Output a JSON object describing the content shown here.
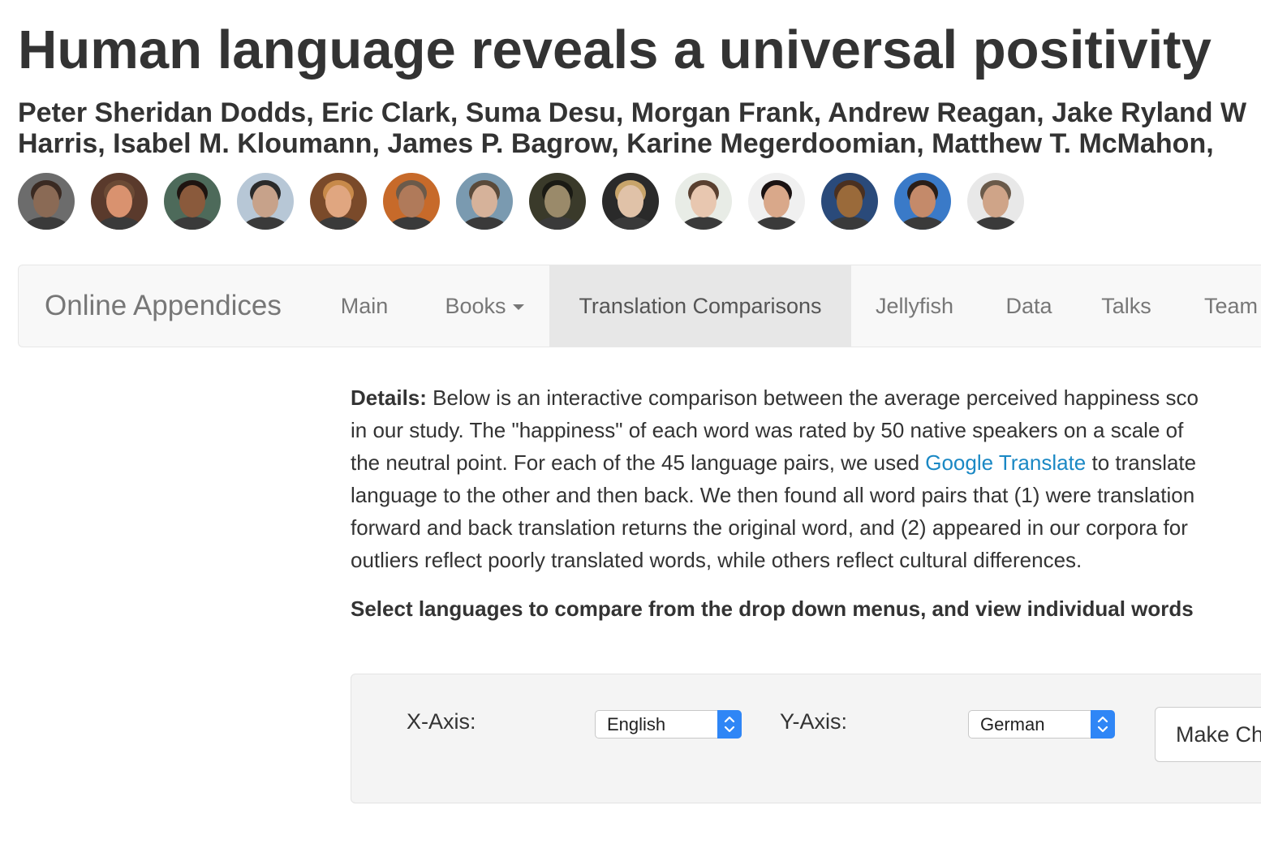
{
  "title": "Human language reveals a universal positivity",
  "authors": {
    "line1": "Peter Sheridan Dodds, Eric Clark, Suma Desu, Morgan Frank, Andrew Reagan, Jake Ryland W",
    "line2": "Harris, Isabel M. Kloumann, James P. Bagrow, Karine Megerdoomian, Matthew T. McMahon,"
  },
  "avatars": [
    {
      "name": "author-1",
      "skin": "#8a6a55",
      "bg": "#6c6c6c",
      "hair": "#3a2a22"
    },
    {
      "name": "author-2",
      "skin": "#d9926f",
      "bg": "#5a3a2c",
      "hair": "#6b4a35"
    },
    {
      "name": "author-3",
      "skin": "#8a5a3c",
      "bg": "#4d6a5a",
      "hair": "#1e1410"
    },
    {
      "name": "author-4",
      "skin": "#c7a28a",
      "bg": "#b7c7d6",
      "hair": "#2a2a2a"
    },
    {
      "name": "author-5",
      "skin": "#e0a680",
      "bg": "#7a4a2a",
      "hair": "#c88a4a"
    },
    {
      "name": "author-6",
      "skin": "#b07a5a",
      "bg": "#c76a2a",
      "hair": "#6b5a4a"
    },
    {
      "name": "author-7",
      "skin": "#d6b29a",
      "bg": "#7a9ab0",
      "hair": "#5a4a3a"
    },
    {
      "name": "author-8",
      "skin": "#9a8a6a",
      "bg": "#3a3a2a",
      "hair": "#1a1a14"
    },
    {
      "name": "author-9",
      "skin": "#e0c2a8",
      "bg": "#2a2a2a",
      "hair": "#c8a46a"
    },
    {
      "name": "author-10",
      "skin": "#e8c7b0",
      "bg": "#e8ece6",
      "hair": "#5a4030"
    },
    {
      "name": "author-11",
      "skin": "#d9a88a",
      "bg": "#f0f0f0",
      "hair": "#1a1212"
    },
    {
      "name": "author-12",
      "skin": "#9a6a3a",
      "bg": "#2a4a7a",
      "hair": "#4a3020"
    },
    {
      "name": "author-13",
      "skin": "#c48a6a",
      "bg": "#3a7ac8",
      "hair": "#2a1e18"
    },
    {
      "name": "author-14",
      "skin": "#cfa488",
      "bg": "#e8e8e8",
      "hair": "#6a5a4a"
    }
  ],
  "navbar": {
    "brand": "Online Appendices",
    "items": [
      {
        "label": "Main",
        "name": "nav-main"
      },
      {
        "label": "Books",
        "name": "nav-books"
      },
      {
        "label": "Translation Comparisons",
        "name": "nav-translation-comparisons",
        "active": true
      },
      {
        "label": "Jellyfish",
        "name": "nav-jellyfish"
      },
      {
        "label": "Data",
        "name": "nav-data"
      },
      {
        "label": "Talks",
        "name": "nav-talks"
      },
      {
        "label": "Team",
        "name": "nav-team"
      }
    ]
  },
  "details": {
    "label": "Details:",
    "line1": " Below is an interactive comparison between the average perceived happiness sco",
    "line2": "in our study. The \"happiness\" of each word was rated by 50 native speakers on a scale of",
    "line3a": "the neutral point. For each of the 45 language pairs, we used ",
    "link": "Google Translate",
    "line3b": " to translate",
    "line4": "language to the other and then back. We then found all word pairs that (1) were translation",
    "line5": "forward and back translation returns the original word, and (2) appeared in our corpora for",
    "line6": "outliers reflect poorly translated words, while others reflect cultural differences."
  },
  "select_note": "Select languages to compare from the drop down menus, and view individual words",
  "controls": {
    "x_label": "X-Axis:",
    "x_value": "English",
    "y_label": "Y-Axis:",
    "y_value": "German",
    "button": "Make Ch"
  },
  "colors": {
    "link": "#1a88c4",
    "stepper": "#2f86f6",
    "nav_active_bg": "#e7e7e7"
  }
}
